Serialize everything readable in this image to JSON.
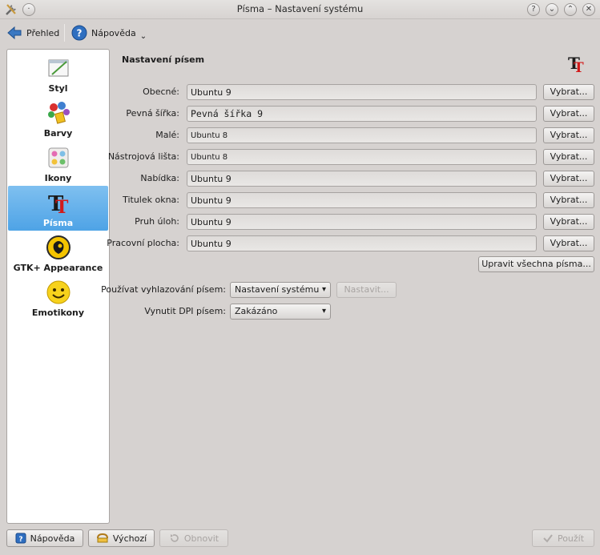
{
  "window": {
    "title": "Písma – Nastavení systému",
    "controls": [
      "?",
      "⌄",
      "⌃",
      "✕"
    ]
  },
  "toolbar": {
    "overview_label": "Přehled",
    "help_label": "Nápověda"
  },
  "sidebar": {
    "items": [
      {
        "label": "Styl",
        "icon": "style-icon"
      },
      {
        "label": "Barvy",
        "icon": "colors-icon"
      },
      {
        "label": "Ikony",
        "icon": "icons-icon"
      },
      {
        "label": "Písma",
        "icon": "fonts-icon",
        "selected": true
      },
      {
        "label": "GTK+ Appearance",
        "icon": "gtk-icon"
      },
      {
        "label": "Emotikony",
        "icon": "emoticons-icon"
      }
    ]
  },
  "main": {
    "section_title": "Nastavení písem",
    "rows": [
      {
        "label": "Obecné:",
        "value": "Ubuntu 9",
        "button": "Vybrat..."
      },
      {
        "label": "Pevná šířka:",
        "value": "Pevná šířka 9",
        "button": "Vybrat..."
      },
      {
        "label": "Malé:",
        "value": "Ubuntu 8",
        "button": "Vybrat..."
      },
      {
        "label": "Nástrojová lišta:",
        "value": "Ubuntu 8",
        "button": "Vybrat..."
      },
      {
        "label": "Nabídka:",
        "value": "Ubuntu 9",
        "button": "Vybrat..."
      },
      {
        "label": "Titulek okna:",
        "value": "Ubuntu 9",
        "button": "Vybrat..."
      },
      {
        "label": "Pruh úloh:",
        "value": "Ubuntu 9",
        "button": "Vybrat..."
      },
      {
        "label": "Pracovní plocha:",
        "value": "Ubuntu 9",
        "button": "Vybrat..."
      }
    ],
    "adjust_all_label": "Upravit všechna písma...",
    "antialias_label": "Používat vyhlazování písem:",
    "antialias_value": "Nastavení systému",
    "configure_label": "Nastavit...",
    "dpi_label": "Vynutit DPI písem:",
    "dpi_value": "Zakázáno"
  },
  "footer": {
    "help_label": "Nápověda",
    "defaults_label": "Výchozí",
    "reset_label": "Obnovit",
    "apply_label": "Použít"
  }
}
